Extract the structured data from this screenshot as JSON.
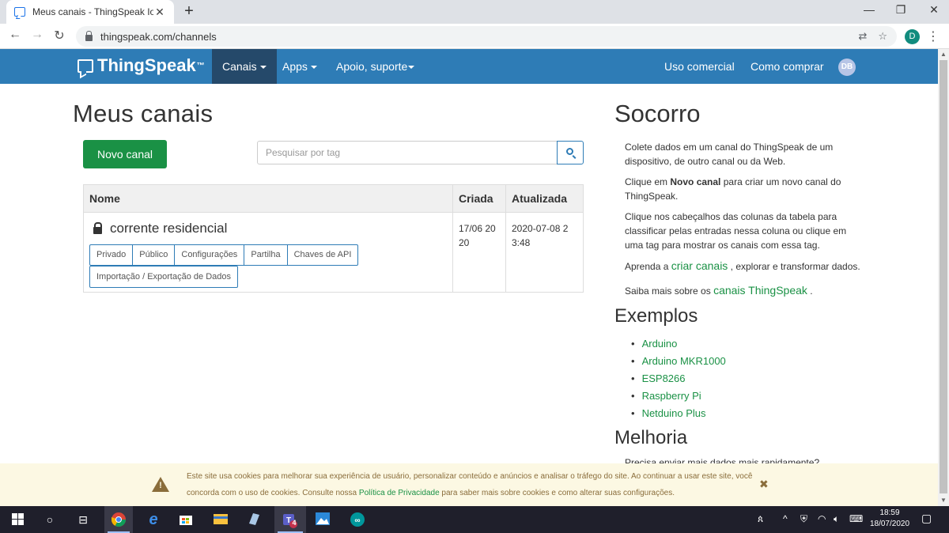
{
  "browser": {
    "tab_title": "Meus canais - ThingSpeak IoT",
    "tab_close": "✕",
    "new_tab": "+",
    "url": "thingspeak.com/channels",
    "profile_initial": "D"
  },
  "navbar": {
    "brand": "ThingSpeak",
    "brand_tm": "™",
    "items": [
      {
        "label": "Canais",
        "active": true,
        "dropdown": true
      },
      {
        "label": "Apps",
        "dropdown": true
      },
      {
        "label": "Apoio, suporte",
        "dropdown": true
      }
    ],
    "right_items": [
      "Uso comercial",
      "Como comprar"
    ],
    "avatar": "DB"
  },
  "main": {
    "title": "Meus canais",
    "new_channel_label": "Novo canal",
    "search_placeholder": "Pesquisar por tag",
    "table": {
      "headers": [
        "Nome",
        "Criada",
        "Atualizada"
      ],
      "rows": [
        {
          "name": "corrente residencial",
          "created": "17/06 20 20",
          "updated": "2020-07-08 2 3:48",
          "actions": [
            "Privado",
            "Público",
            "Configurações",
            "Partilha",
            "Chaves de API"
          ],
          "extra_action": "Importação / Exportação de Dados"
        }
      ]
    }
  },
  "sidebar": {
    "title": "Socorro",
    "p1": "Colete dados em um canal do ThingSpeak de um dispositivo, de outro canal ou da Web.",
    "p2_pre": "Clique em ",
    "p2_bold": "Novo canal",
    "p2_post": " para criar um novo canal do ThingSpeak.",
    "p3": "Clique nos cabeçalhos das colunas da tabela para classificar pelas entradas nessa coluna ou clique em uma tag para mostrar os canais com essa tag.",
    "p4_pre": "Aprenda a ",
    "p4_link": "criar canais",
    "p4_post": " , explorar e transformar dados.",
    "p5_pre": "Saiba mais sobre os ",
    "p5_link": "canais ThingSpeak",
    "p5_post": " .",
    "examples_title": "Exemplos",
    "examples": [
      "Arduino",
      "Arduino MKR1000",
      "ESP8266",
      "Raspberry Pi",
      "Netduino Plus"
    ],
    "improve_title": "Melhoria",
    "improve_text": "Precisa enviar mais dados mais rapidamente?"
  },
  "cookie": {
    "text_pre": "Este site usa cookies para melhorar sua experiência de usuário, personalizar conteúdo e anúncios e analisar o tráfego do site. Ao continuar a usar este site, você concorda com o uso de cookies. Consulte nossa ",
    "link": "Política de Privacidade",
    "text_post": " para saber mais sobre cookies e como alterar suas configurações.",
    "close": "✖"
  },
  "taskbar": {
    "time": "18:59",
    "date": "18/07/2020",
    "teams_badge": "4"
  },
  "colors": {
    "navbar": "#2e7cb6",
    "nav_active": "#25496a",
    "green": "#1a9145",
    "cookie_bg": "#fcf8e3",
    "cookie_text": "#8a6d3b"
  }
}
